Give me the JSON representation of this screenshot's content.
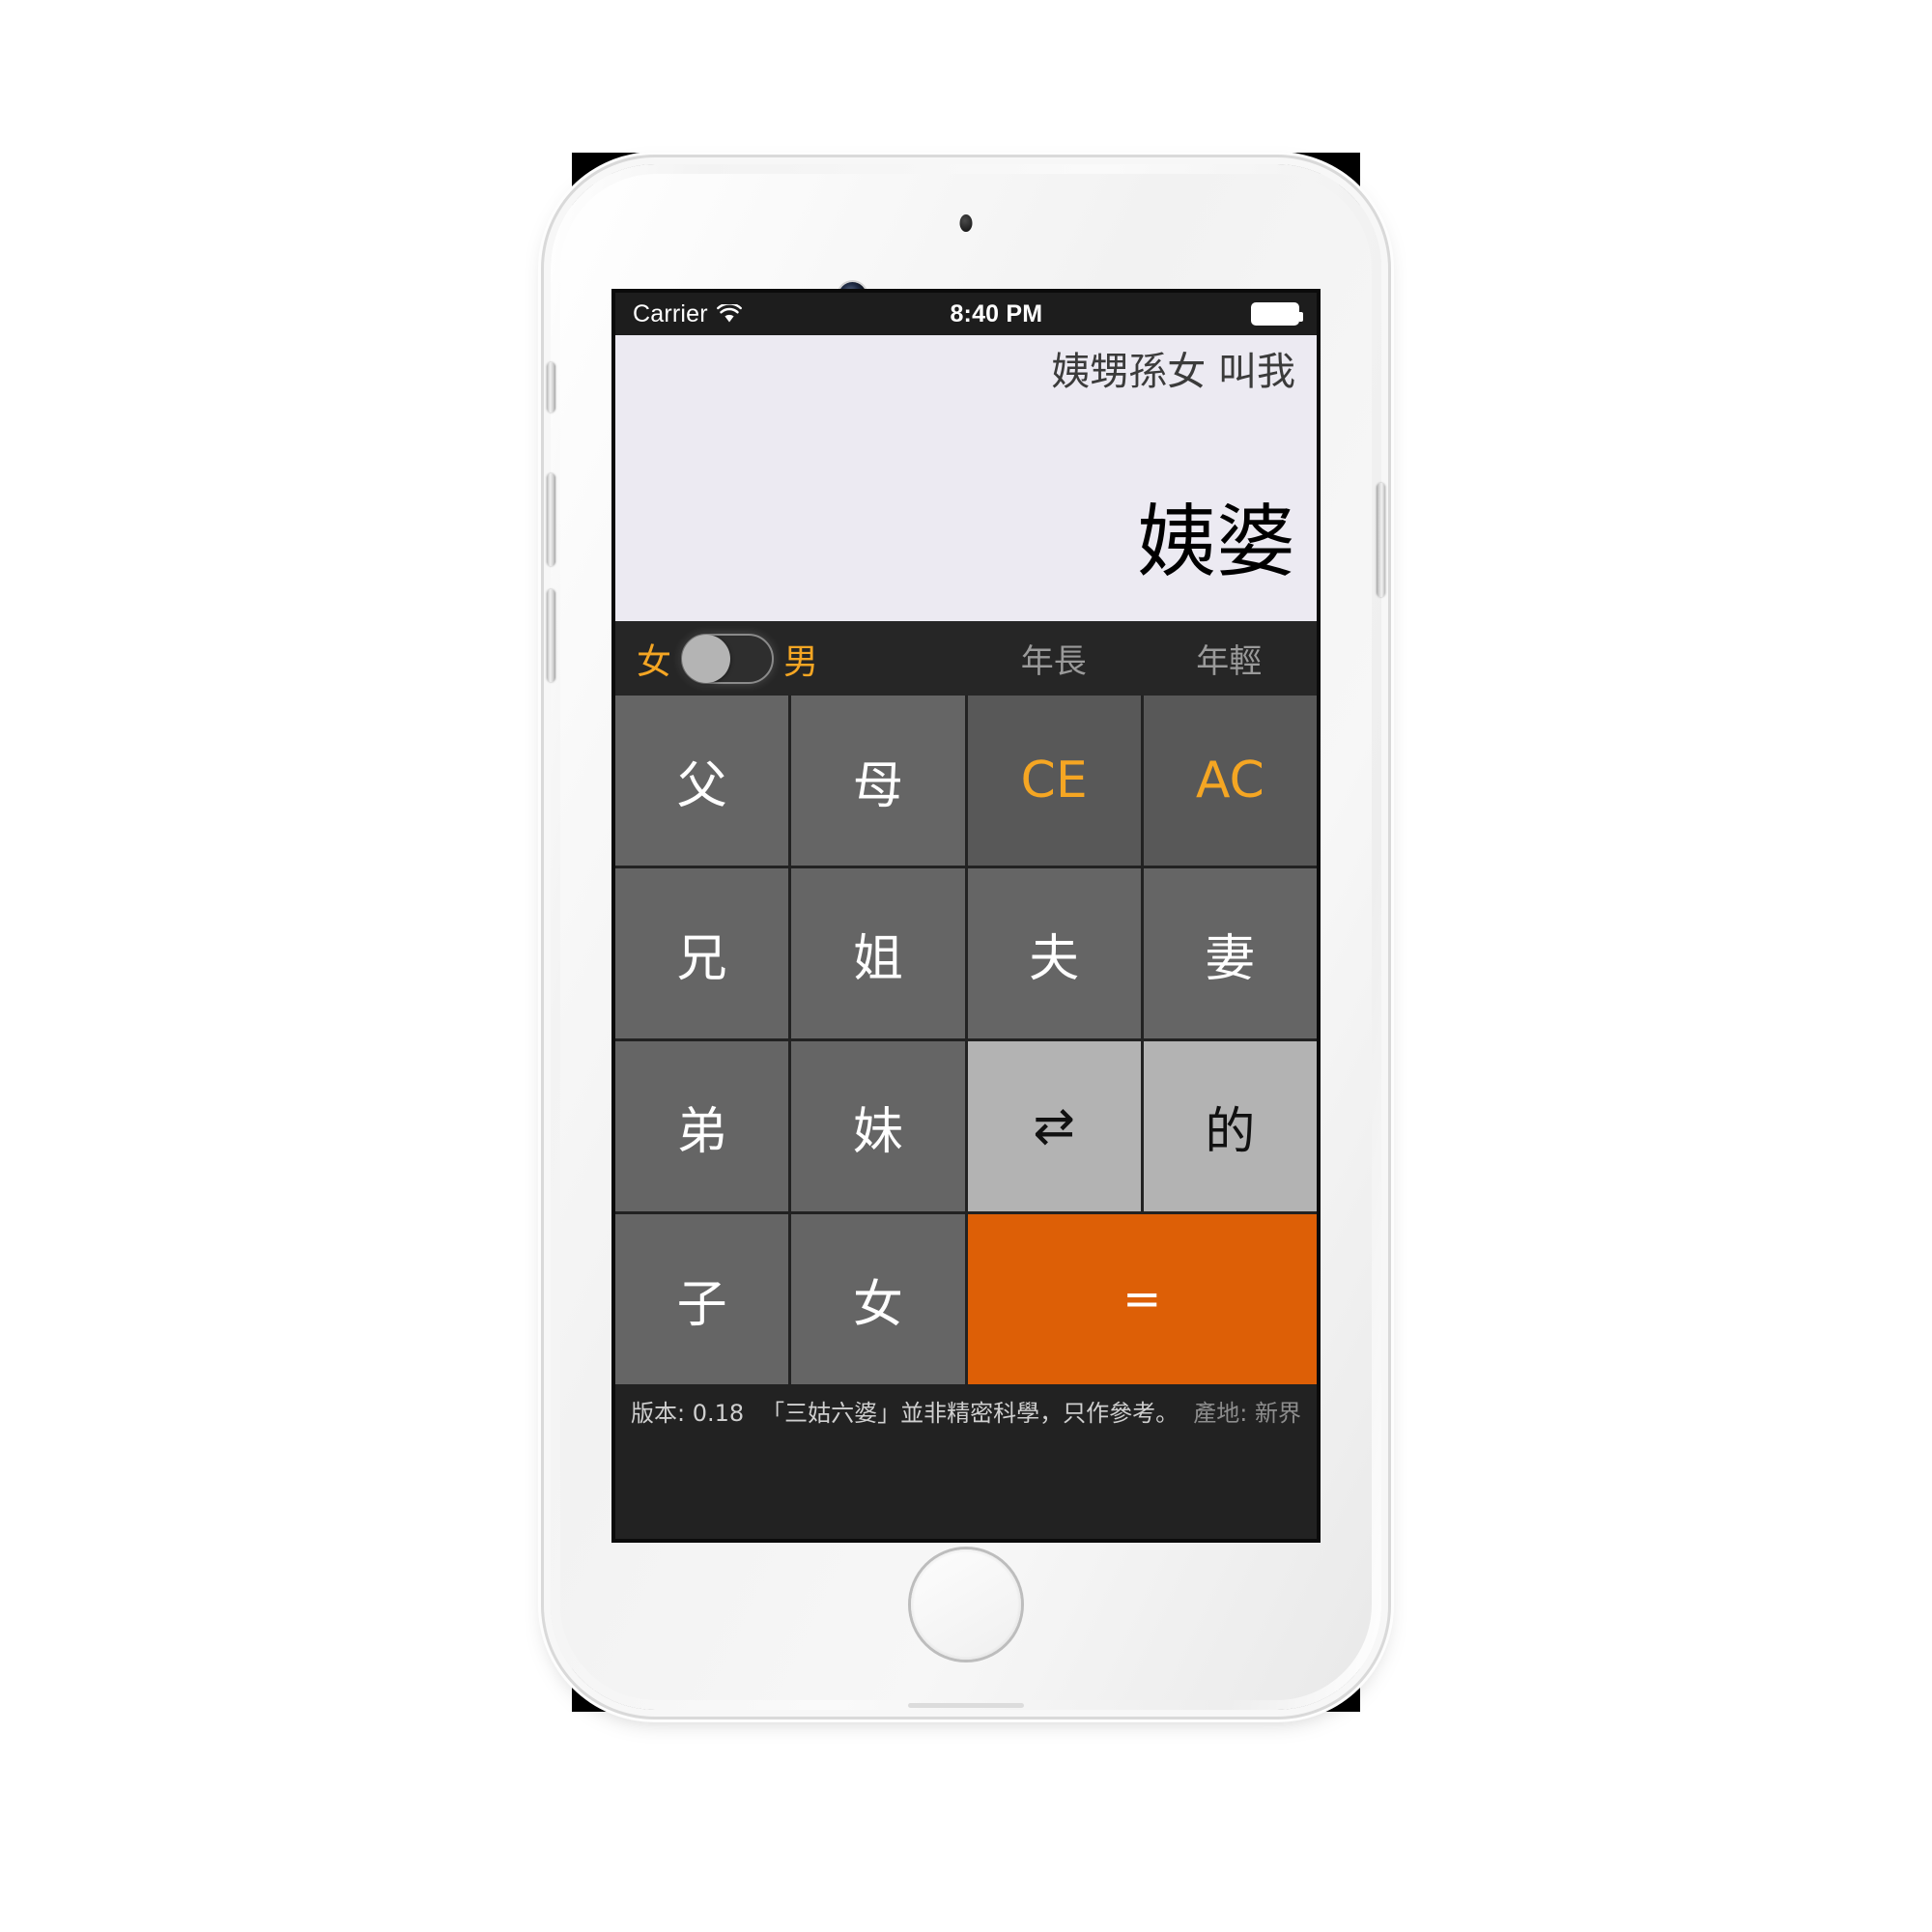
{
  "device": {
    "name": "iphone-6-silver",
    "hardware": {
      "mute_switch": "mute-switch",
      "volume_up": "volume-up-button",
      "volume_down": "volume-down-button",
      "power": "power-button",
      "home": "home-button",
      "front_camera": "front-camera",
      "earpiece": "earpiece-speaker",
      "proximity_sensor": "proximity-sensor"
    }
  },
  "statusbar": {
    "carrier": "Carrier",
    "wifi_icon": "wifi-icon",
    "time": "8:40 PM",
    "battery_icon": "battery-full-icon"
  },
  "display": {
    "expression": "姨甥孫女 叫我",
    "result": "姨婆"
  },
  "toggles": {
    "gender_left_label": "女",
    "gender_right_label": "男",
    "switch_state": "off",
    "age_older_label": "年長",
    "age_younger_label": "年輕"
  },
  "keypad": {
    "keys": [
      {
        "label": "父",
        "kind": "num"
      },
      {
        "label": "母",
        "kind": "num"
      },
      {
        "label": "CE",
        "kind": "fn"
      },
      {
        "label": "AC",
        "kind": "fn"
      },
      {
        "label": "兄",
        "kind": "num"
      },
      {
        "label": "姐",
        "kind": "num"
      },
      {
        "label": "夫",
        "kind": "num"
      },
      {
        "label": "妻",
        "kind": "num"
      },
      {
        "label": "弟",
        "kind": "num"
      },
      {
        "label": "妹",
        "kind": "num"
      },
      {
        "label": "⇄",
        "kind": "light"
      },
      {
        "label": "的",
        "kind": "light"
      },
      {
        "label": "子",
        "kind": "num"
      },
      {
        "label": "女",
        "kind": "num"
      },
      {
        "label": "=",
        "kind": "eq"
      }
    ]
  },
  "footer": {
    "version": "版本: 0.18",
    "note": "「三姑六婆」並非精密科學，只作參考。",
    "origin": "產地: 新界"
  },
  "colors": {
    "accent_yellow": "#f5a623",
    "equals_orange": "#dd5f06",
    "key_gray": "#656565",
    "key_fn_gray": "#585858",
    "key_light_gray": "#b3b3b3",
    "screen_dark": "#222222",
    "display_bg": "#eceaf2"
  }
}
